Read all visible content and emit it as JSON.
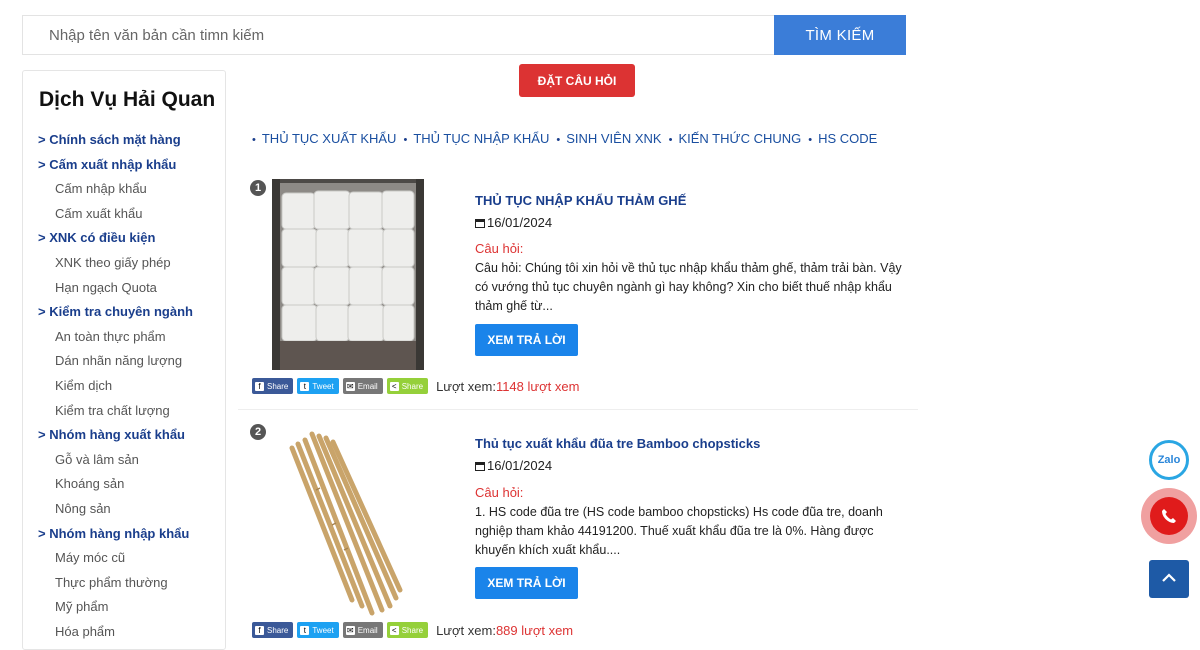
{
  "search": {
    "placeholder": "Nhập tên văn bản cần timn kiếm",
    "button": "TÌM KIẾM"
  },
  "sidebar": {
    "title": "Dịch Vụ Hải Quan",
    "items": [
      {
        "label": "> Chính sách mặt hàng",
        "type": "cat"
      },
      {
        "label": "> Cấm xuất nhập khẩu",
        "type": "cat"
      },
      {
        "label": "Cấm nhập khẩu",
        "type": "sub"
      },
      {
        "label": "Cấm xuất khẩu",
        "type": "sub"
      },
      {
        "label": "> XNK có điều kiện",
        "type": "cat"
      },
      {
        "label": "XNK theo giấy phép",
        "type": "sub"
      },
      {
        "label": "Hạn ngạch Quota",
        "type": "sub"
      },
      {
        "label": "> Kiểm tra chuyên ngành",
        "type": "cat"
      },
      {
        "label": "An toàn thực phẩm",
        "type": "sub"
      },
      {
        "label": "Dán nhãn năng lượng",
        "type": "sub"
      },
      {
        "label": "Kiểm dịch",
        "type": "sub"
      },
      {
        "label": "Kiểm tra chất lượng",
        "type": "sub"
      },
      {
        "label": "> Nhóm hàng xuất khẩu",
        "type": "cat"
      },
      {
        "label": "Gỗ và lâm sản",
        "type": "sub"
      },
      {
        "label": "Khoáng sản",
        "type": "sub"
      },
      {
        "label": "Nông sản",
        "type": "sub"
      },
      {
        "label": "> Nhóm hàng nhập khẩu",
        "type": "cat"
      },
      {
        "label": "Máy móc cũ",
        "type": "sub"
      },
      {
        "label": "Thực phẩm thường",
        "type": "sub"
      },
      {
        "label": "Mỹ phẩm",
        "type": "sub"
      },
      {
        "label": "Hóa phẩm",
        "type": "sub"
      }
    ]
  },
  "ask_button": "ĐẶT CÂU HỎI",
  "categories": [
    "THỦ TỤC XUẤT KHẨU",
    "THỦ TỤC NHẬP KHẨU",
    "SINH VIÊN XNK",
    "KIẾN THỨC CHUNG",
    "HS CODE"
  ],
  "bullet": "•",
  "items": [
    {
      "index": "1",
      "title": "THỦ TỤC NHẬP KHẨU THẢM GHẾ",
      "date": "16/01/2024",
      "question_label": "Câu hỏi:",
      "question": "Câu hỏi: Chúng tôi xin hỏi về thủ tục nhập khẩu thảm ghế, thảm trải bàn. Vậy có vướng thủ tục chuyên ngành gì hay không? Xin cho biết thuế nhập khẩu thảm ghế từ...",
      "button": "XEM TRẢ LỜI",
      "views_label": "Lượt xem:",
      "views": "1148 lượt xem"
    },
    {
      "index": "2",
      "title": "Thủ tục xuất khẩu đũa tre Bamboo chopsticks",
      "date": "16/01/2024",
      "question_label": "Câu hỏi:",
      "question": "1. HS code đũa tre (HS code bamboo chopsticks) Hs code đũa tre, doanh nghiệp tham khảo 44191200. Thuế xuất khẩu đũa tre là 0%. Hàng được khuyến khích xuất khẩu....",
      "button": "XEM TRẢ LỜI",
      "views_label": "Lượt xem:",
      "views": "889 lượt xem"
    }
  ],
  "share": {
    "facebook": "Share",
    "twitter": "Tweet",
    "email": "Email",
    "share": "Share"
  },
  "floating": {
    "zalo": "Zalo"
  },
  "colors": {
    "accent": "#3b7dd8",
    "link": "#1a3e8c",
    "danger": "#dc3333",
    "button": "#1a84ea"
  }
}
